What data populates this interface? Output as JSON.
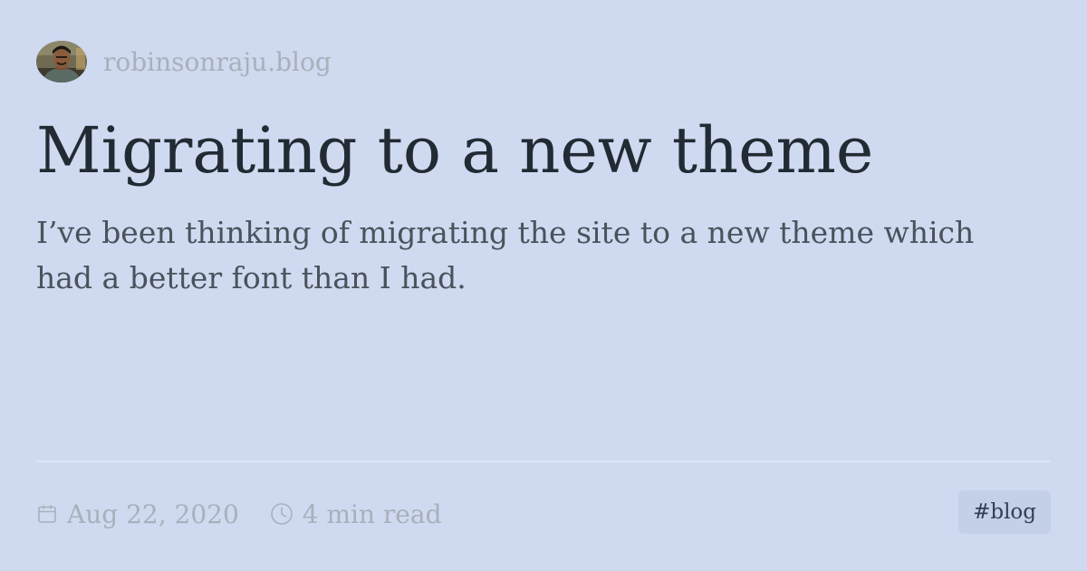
{
  "site": {
    "name": "robinsonraju.blog",
    "avatar_icon": "author-avatar-photo"
  },
  "post": {
    "title": "Migrating to a new theme",
    "summary": "I’ve been thinking of migrating the site to a new theme which had a better font than I had.",
    "date": "Aug 22, 2020",
    "reading_time": "4 min read",
    "tag": "#blog"
  },
  "icons": {
    "date": "calendar-icon",
    "reading_time": "clock-icon"
  },
  "colors": {
    "background": "#cfdaf1",
    "title": "#222a33",
    "summary": "#4a525b",
    "muted": "#a9b0bb",
    "tag_background": "#c4d0e8",
    "tag_text": "#2f3f56"
  }
}
